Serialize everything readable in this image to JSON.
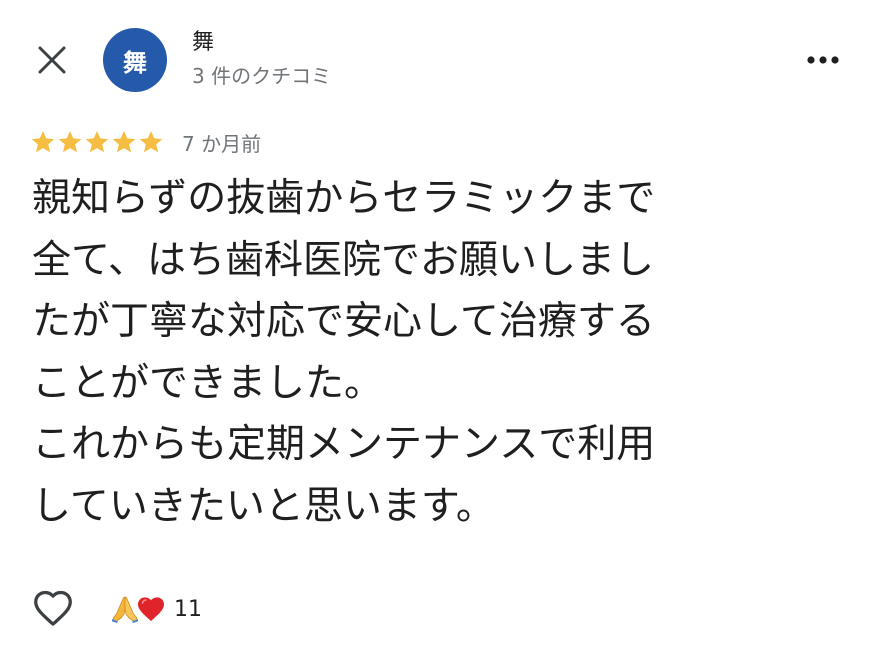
{
  "header": {
    "author_initial": "舞",
    "author_name": "舞",
    "review_count": "3 件のクチコミ",
    "avatar_color": "#2559a9"
  },
  "review": {
    "rating": 5,
    "max_rating": 5,
    "star_color": "#f5bd41",
    "date": "7 か月前",
    "text_lines": [
      "親知らずの抜歯からセラミックまで",
      "全て、はち歯科医院でお願いしまし",
      "たが丁寧な対応で安心して治療する",
      "ことができました。",
      "これからも定期メンテナンスで利用",
      "していきたいと思います。"
    ]
  },
  "footer": {
    "like_icon": "heart-outline-icon",
    "reaction_icons": [
      "folded-hands-icon",
      "red-heart-icon"
    ],
    "reaction_count": "11"
  }
}
